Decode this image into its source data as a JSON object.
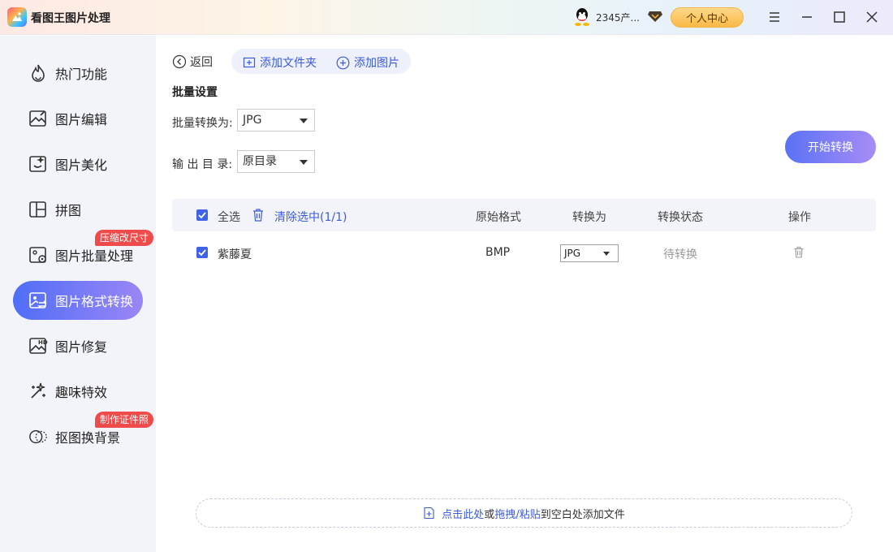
{
  "app": {
    "title": "看图王图片处理"
  },
  "user": {
    "name": "2345产...",
    "center_label": "个人中心"
  },
  "sidebar": {
    "items": [
      {
        "label": "热门功能",
        "icon": "flame-icon"
      },
      {
        "label": "图片编辑",
        "icon": "image-edit-icon"
      },
      {
        "label": "图片美化",
        "icon": "image-beautify-icon"
      },
      {
        "label": "拼图",
        "icon": "collage-icon"
      },
      {
        "label": "图片批量处理",
        "icon": "batch-icon",
        "badge": "压缩改尺寸"
      },
      {
        "label": "图片格式转换",
        "icon": "image-convert-icon",
        "active": true
      },
      {
        "label": "图片修复",
        "icon": "hd-icon"
      },
      {
        "label": "趣味特效",
        "icon": "magic-wand-icon"
      },
      {
        "label": "抠图换背景",
        "icon": "cutout-icon",
        "badge": "制作证件照"
      }
    ]
  },
  "toolbar": {
    "back_label": "返回",
    "add_folder_label": "添加文件夹",
    "add_image_label": "添加图片"
  },
  "batch": {
    "section_title": "批量设置",
    "convert_label": "批量转换为:",
    "convert_value": "JPG",
    "output_label": "输 出 目 录:",
    "output_value": "原目录",
    "start_label": "开始转换"
  },
  "table": {
    "select_all_label": "全选",
    "clear_label": "清除选中(1/1)",
    "headers": {
      "original_format": "原始格式",
      "convert_to": "转换为",
      "status": "转换状态",
      "action": "操作"
    },
    "rows": [
      {
        "name": "紫藤夏",
        "original_format": "BMP",
        "convert_to": "JPG",
        "status": "待转换"
      }
    ]
  },
  "dropzone": {
    "click_text": "点击此处",
    "or_text": "或",
    "drag_text": "拖拽/粘贴",
    "rest_text": "到空白处添加文件"
  },
  "colors": {
    "accent": "#3f63e8",
    "badge": "#f04b4b",
    "vip": "#f9b946"
  }
}
